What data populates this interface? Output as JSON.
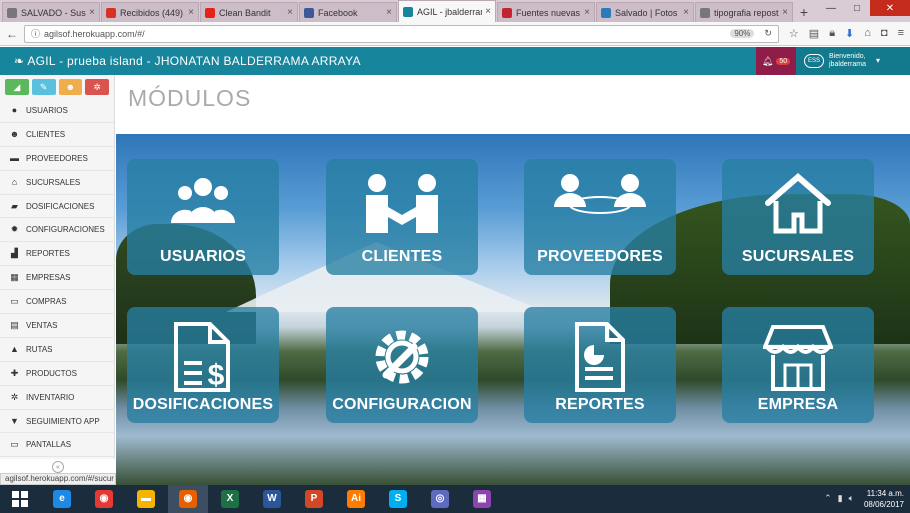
{
  "browser": {
    "tabs": [
      {
        "title": "SALVADO - Sus",
        "color": "#777777"
      },
      {
        "title": "Recibidos (449)",
        "color": "#d93025"
      },
      {
        "title": "Clean Bandit",
        "color": "#e62117"
      },
      {
        "title": "Facebook",
        "color": "#3b5998"
      },
      {
        "title": "AGIL - jbalderrama",
        "color": "#17869c"
      },
      {
        "title": "Fuentes nuevas",
        "color": "#c0262d"
      },
      {
        "title": "Salvado | Fotos",
        "color": "#2b7bb9"
      },
      {
        "title": "tipografia repost",
        "color": "#777777"
      }
    ],
    "url": "agilsof.herokuapp.com/#/",
    "zoom": "90%"
  },
  "header": {
    "brand": "AGIL - prueba island - JHONATAN BALDERRAMA ARRAYA",
    "notif_count": "50",
    "welcome": "Bienvenido,",
    "username": "jbalderrama",
    "avatar_text": "ESS"
  },
  "sidebar": {
    "quick_buttons": [
      {
        "icon": "chart-icon",
        "color": "#5cb85c",
        "glyph": "◢"
      },
      {
        "icon": "pencil-icon",
        "color": "#5bc0de",
        "glyph": "✎"
      },
      {
        "icon": "users-icon",
        "color": "#f0ad4e",
        "glyph": "☻"
      },
      {
        "icon": "cogs-icon",
        "color": "#d9534f",
        "glyph": "✲"
      }
    ],
    "items": [
      {
        "label": "USUARIOS",
        "icon": "user-icon",
        "glyph": "●"
      },
      {
        "label": "CLIENTES",
        "icon": "group-icon",
        "glyph": "☻"
      },
      {
        "label": "PROVEEDORES",
        "icon": "truck-icon",
        "glyph": "▬"
      },
      {
        "label": "SUCURSALES",
        "icon": "home-icon",
        "glyph": "⌂"
      },
      {
        "label": "DOSIFICACIONES",
        "icon": "book-icon",
        "glyph": "▰"
      },
      {
        "label": "CONFIGURACIONES",
        "icon": "cog-icon",
        "glyph": "✹"
      },
      {
        "label": "REPORTES",
        "icon": "bar-chart-icon",
        "glyph": "▟"
      },
      {
        "label": "EMPRESAS",
        "icon": "building-icon",
        "glyph": "▦"
      },
      {
        "label": "COMPRAS",
        "icon": "credit-card-icon",
        "glyph": "▭"
      },
      {
        "label": "VENTAS",
        "icon": "table-icon",
        "glyph": "▤"
      },
      {
        "label": "RUTAS",
        "icon": "road-icon",
        "glyph": "▲"
      },
      {
        "label": "PRODUCTOS",
        "icon": "gift-icon",
        "glyph": "✚"
      },
      {
        "label": "INVENTARIO",
        "icon": "cogs-icon",
        "glyph": "✲"
      },
      {
        "label": "SEGUIMIENTO APP",
        "icon": "filter-icon",
        "glyph": "▼"
      },
      {
        "label": "PANTALLAS",
        "icon": "monitor-icon",
        "glyph": "▭"
      }
    ]
  },
  "status_url": "agilsof.herokuapp.com/#/sucur",
  "page": {
    "title": "MÓDULOS",
    "modules": [
      "USUARIOS",
      "CLIENTES",
      "PROVEEDORES",
      "SUCURSALES",
      "DOSIFICACIONES",
      "CONFIGURACION",
      "REPORTES",
      "EMPRESA"
    ]
  },
  "taskbar": {
    "time": "11:34 a.m.",
    "date": "08/06/2017",
    "apps": [
      {
        "name": "ie-icon",
        "color": "#1e88e5",
        "glyph": "e"
      },
      {
        "name": "chrome-icon",
        "color": "#e53935",
        "glyph": "◉"
      },
      {
        "name": "explorer-icon",
        "color": "#f4b400",
        "glyph": "▬"
      },
      {
        "name": "firefox-icon",
        "color": "#e66000",
        "glyph": "◉"
      },
      {
        "name": "excel-icon",
        "color": "#1e7145",
        "glyph": "X"
      },
      {
        "name": "word-icon",
        "color": "#2b579a",
        "glyph": "W"
      },
      {
        "name": "powerpoint-icon",
        "color": "#d24726",
        "glyph": "P"
      },
      {
        "name": "illustrator-icon",
        "color": "#ff7c00",
        "glyph": "Ai"
      },
      {
        "name": "skype-icon",
        "color": "#00aff0",
        "glyph": "S"
      },
      {
        "name": "media-icon",
        "color": "#5c6bc0",
        "glyph": "◎"
      },
      {
        "name": "flag-icon",
        "color": "#8e44ad",
        "glyph": "▦"
      }
    ]
  }
}
